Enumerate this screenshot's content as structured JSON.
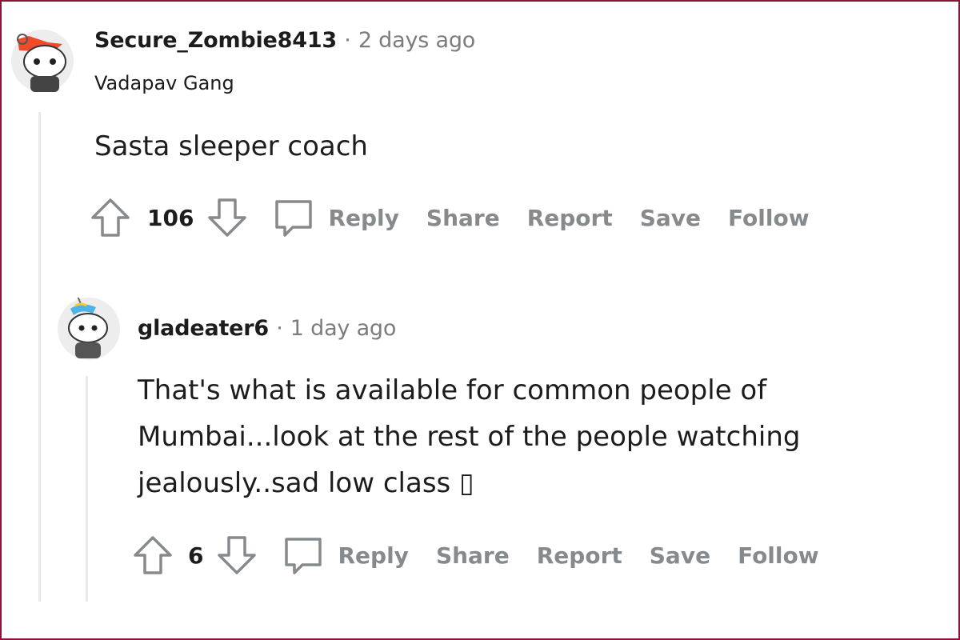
{
  "comments": [
    {
      "username": "Secure_Zombie8413",
      "separator": "·",
      "timestamp": "2 days ago",
      "flair": "Vadapav Gang",
      "body": "Sasta sleeper coach",
      "score": "106",
      "actions": {
        "reply": "Reply",
        "share": "Share",
        "report": "Report",
        "save": "Save",
        "follow": "Follow"
      }
    },
    {
      "username": "gladeater6",
      "separator": "·",
      "timestamp": "1 day ago",
      "body_lines": [
        "That's what is available for common people of",
        "Mumbai...look at the rest of the people watching",
        "jealously..sad low class ▯"
      ],
      "score": "6",
      "actions": {
        "reply": "Reply",
        "share": "Share",
        "report": "Report",
        "save": "Save",
        "follow": "Follow"
      }
    }
  ],
  "colors": {
    "border": "#8a1538",
    "action_grey": "#878a8c",
    "thread_line": "#e9e9e9"
  }
}
